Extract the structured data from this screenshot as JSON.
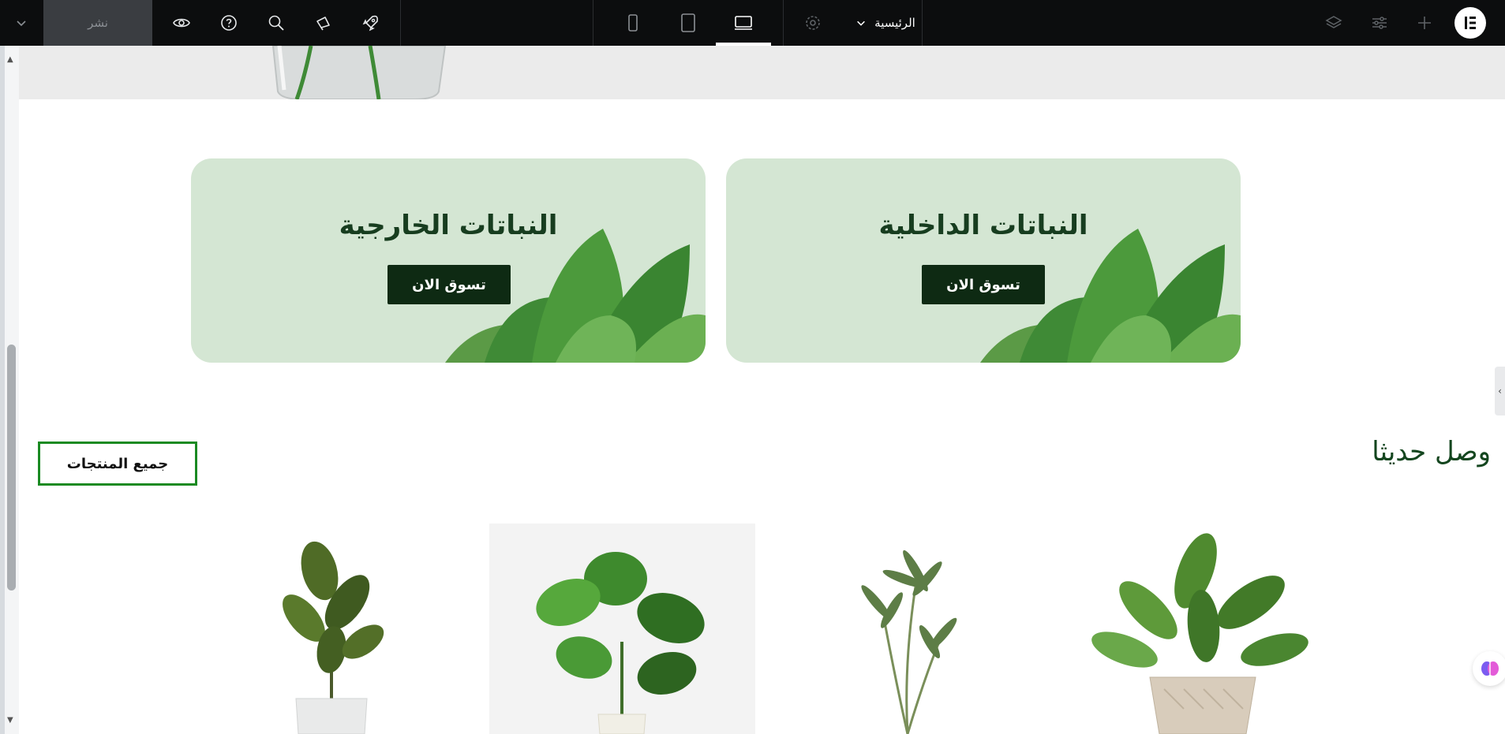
{
  "toolbar": {
    "publish_label": "نشر",
    "page_name": "الرئيسية"
  },
  "categories": [
    {
      "title": "النباتات الخارجية",
      "button": "تسوق الان"
    },
    {
      "title": "النباتات الداخلية",
      "button": "تسوق الان"
    }
  ],
  "section": {
    "title": "وصل حديثا",
    "all_products_label": "جميع المنتجات"
  },
  "colors": {
    "toolbar_bg": "#0c0d0e",
    "card_bg": "#d4e6d3",
    "button_bg": "#0e2a13",
    "title_green": "#173d1f",
    "outline_green": "#1a8a22"
  }
}
